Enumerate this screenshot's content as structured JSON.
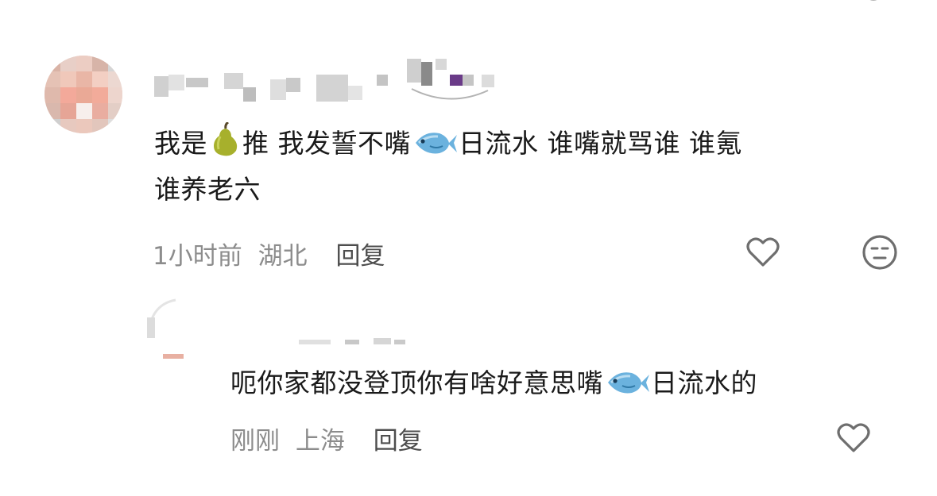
{
  "comment": {
    "text_line1_part1": "我是",
    "text_line1_part2": "推 我发誓不嘴",
    "text_line1_part3": "日流水 谁嘴就骂谁 谁氪",
    "text_line2": "谁养老六",
    "emoji_1": "pear-emoji",
    "emoji_2": "fish-emoji",
    "time": "1小时前",
    "location": "湖北",
    "reply_label": "回复"
  },
  "reply": {
    "text_part1": "呃你家都没登顶你有啥好意思嘴",
    "text_part2": "日流水的",
    "emoji": "fish-emoji",
    "time": "刚刚",
    "location": "上海",
    "reply_label": "回复"
  },
  "icons": {
    "like": "heart-outline-icon",
    "dislike": "meh-face-icon"
  },
  "colors": {
    "meta_text": "#8c8c8c",
    "reply_link": "#4d4d4d",
    "icon_stroke": "#6e6e6e"
  }
}
